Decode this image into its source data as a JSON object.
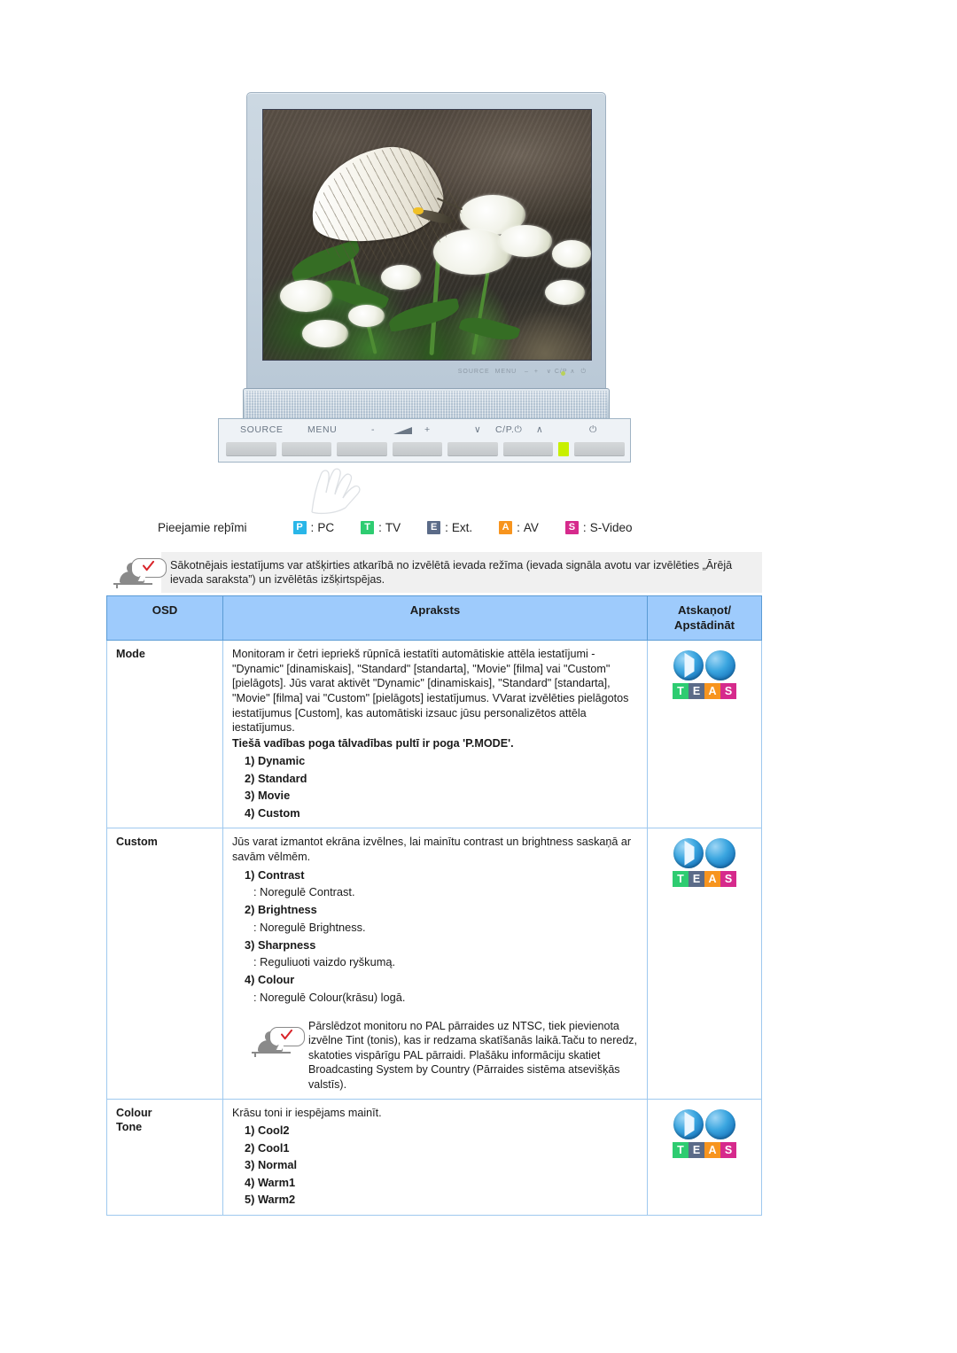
{
  "figure": {
    "alt_description": "CRT/LCD monitor displaying a white butterfly resting on white flowers, with front control panel below",
    "control_panel": {
      "labels": [
        "SOURCE",
        "MENU",
        "-",
        "volume-icon",
        "+",
        "down-chevron",
        "C/P.⏻",
        "up-chevron",
        "power-icon"
      ],
      "led_color": "#c8f000"
    }
  },
  "modes": {
    "label": "Pieejamie reþîmi",
    "items": [
      {
        "badge": "P",
        "sep": ":",
        "name": "PC",
        "color": "#29b6e8"
      },
      {
        "badge": "T",
        "sep": ":",
        "name": "TV",
        "color": "#2ecc71"
      },
      {
        "badge": "E",
        "sep": ":",
        "name": "Ext.",
        "color": "#5b6b88"
      },
      {
        "badge": "A",
        "sep": ":",
        "name": "AV",
        "color": "#f7941e"
      },
      {
        "badge": "S",
        "sep": ":",
        "name": "S-Video",
        "color": "#d62a8c"
      }
    ]
  },
  "note_banner": {
    "icon": "note-person-icon",
    "text": "Sākotnējais iestatījums var atšķirties atkarībā no izvēlētā ievada režīma (ievada signāla avotu var izvēlēties „Ārējā ievada saraksta”) un izvēlētās izšķirtspējas."
  },
  "table": {
    "headers": {
      "osd": "OSD",
      "description": "Apraksts",
      "reset_line1": "Atskaņot/",
      "reset_line2": "Apstādināt"
    },
    "rows": [
      {
        "osd": "Mode",
        "paragraphs": [
          "Monitoram ir četri iepriekš rūpnīcā iestatīti automātiskie attēla iestatījumi - \"Dynamic\" [dinamiskais], \"Standard\" [standarta], \"Movie\" [filma] vai \"Custom\" [pielāgots]. Jūs varat aktivēt \"Dynamic\" [dinamiskais], \"Standard\" [standarta], \"Movie\" [filma] vai \"Custom\" [pielāgots] iestatījumus. VVarat izvēlēties pielāgotos iestatījumus [Custom], kas automātiski izsauc jūsu personalizētos attēla iestatījumus."
        ],
        "bold_line": "Tiešā vadības poga tālvadības pultī ir poga 'P.MODE'.",
        "list": [
          {
            "num": "1)",
            "label": "Dynamic"
          },
          {
            "num": "2)",
            "label": "Standard"
          },
          {
            "num": "3)",
            "label": "Movie"
          },
          {
            "num": "4)",
            "label": "Custom"
          }
        ],
        "reset_icon": "teas-icon"
      },
      {
        "osd": "Custom",
        "paragraphs": [
          "Jūs varat izmantot ekrāna izvēlnes, lai mainītu contrast un brightness saskaņā ar savām vēlmēm."
        ],
        "list": [
          {
            "num": "1)",
            "label": "Contrast",
            "sub": ": Noregulē Contrast."
          },
          {
            "num": "2)",
            "label": "Brightness",
            "sub": ": Noregulē Brightness."
          },
          {
            "num": "3)",
            "label": "Sharpness",
            "sub": ": Reguliuoti vaizdo ryškumą."
          },
          {
            "num": "4)",
            "label": "Colour",
            "sub": ": Noregulē Colour(krāsu) logā."
          }
        ],
        "inner_note": "Pārslēdzot monitoru no PAL pārraides uz NTSC, tiek pievienota izvēlne Tint (tonis), kas ir redzama skatīšanās laikā.Taču to neredz, skatoties vispārīgu PAL pārraidi. Plašāku informāciju skatiet Broadcasting System by Country (Pārraides sistēma atsevišķās valstīs).",
        "reset_icon": "teas-icon"
      },
      {
        "osd": "Colour\nTone",
        "osd_line1": "Colour",
        "osd_line2": "Tone",
        "paragraphs": [
          "Krāsu toni ir iespējams mainīt."
        ],
        "list": [
          {
            "num": "1)",
            "label": "Cool2"
          },
          {
            "num": "2)",
            "label": "Cool1"
          },
          {
            "num": "3)",
            "label": "Normal"
          },
          {
            "num": "4)",
            "label": "Warm1"
          },
          {
            "num": "5)",
            "label": "Warm2"
          }
        ],
        "reset_icon": "teas-icon"
      }
    ]
  },
  "teas_icon": {
    "letters": [
      {
        "char": "T",
        "color": "#2ecc71"
      },
      {
        "char": "E",
        "color": "#5b6b88"
      },
      {
        "char": "A",
        "color": "#f7941e"
      },
      {
        "char": "S",
        "color": "#d62a8c"
      }
    ]
  },
  "colors": {
    "table_header_bg": "#9ecbfc",
    "table_border": "#9fc9ef",
    "table_outer_border": "#5a9bd5",
    "note_bg": "#f0f0f0"
  }
}
